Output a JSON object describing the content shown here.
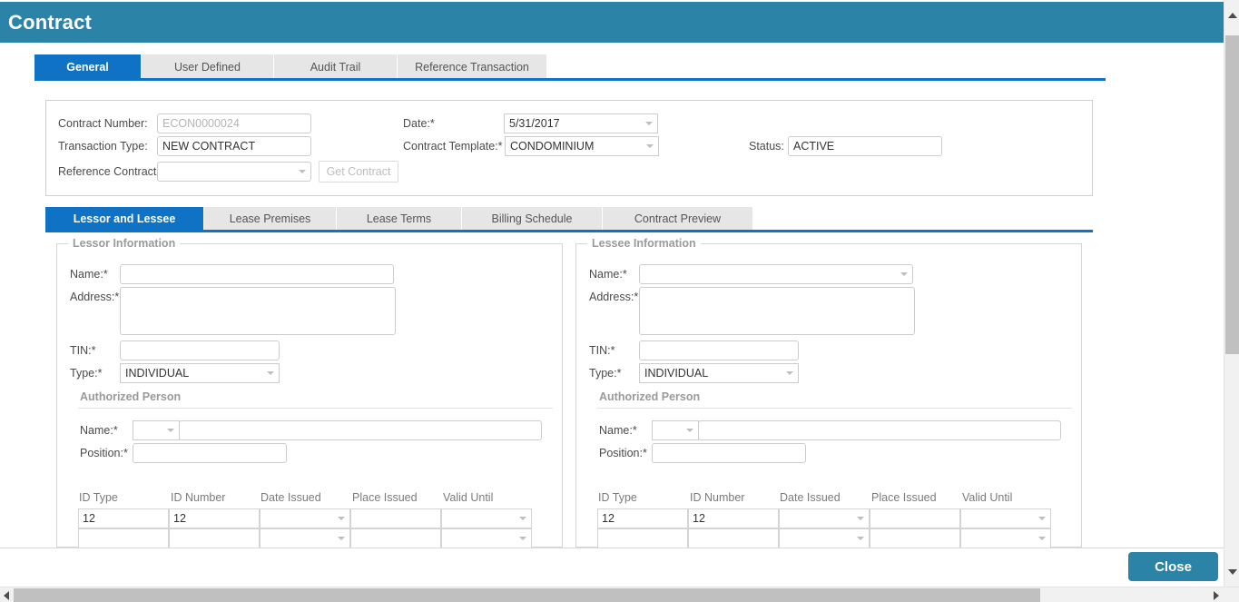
{
  "window": {
    "title": "Contract"
  },
  "colors": {
    "header_teal": "#2c83a8",
    "tab_active_blue": "#0f72c4",
    "tab_inactive_grey": "#e6e6e6",
    "close_button": "#2c83a8",
    "field_border": "#cccccc",
    "legend_grey": "#9a9a9a"
  },
  "main_tabs": [
    {
      "label": "General",
      "active": true
    },
    {
      "label": "User Defined",
      "active": false
    },
    {
      "label": "Audit Trail",
      "active": false
    },
    {
      "label": "Reference Transaction",
      "active": false
    }
  ],
  "header_form": {
    "contract_number": {
      "label": "Contract Number:",
      "value": "ECON0000024",
      "readonly": true
    },
    "transaction_type": {
      "label": "Transaction Type:",
      "value": "NEW CONTRACT"
    },
    "reference_contract": {
      "label": "Reference Contract:",
      "value": ""
    },
    "get_contract_button": {
      "label": "Get Contract",
      "disabled": true
    },
    "date": {
      "label": "Date:*",
      "value": "5/31/2017"
    },
    "contract_template": {
      "label": "Contract Template:*",
      "value": "CONDOMINIUM"
    },
    "status": {
      "label": "Status:",
      "value": "ACTIVE"
    }
  },
  "sub_tabs": [
    {
      "label": "Lessor and Lessee",
      "active": true
    },
    {
      "label": "Lease Premises",
      "active": false
    },
    {
      "label": "Lease Terms",
      "active": false
    },
    {
      "label": "Billing Schedule",
      "active": false
    },
    {
      "label": "Contract Preview",
      "active": false
    }
  ],
  "lessor": {
    "legend": "Lessor Information",
    "name": {
      "label": "Name:*",
      "value": ""
    },
    "address": {
      "label": "Address:*",
      "value": ""
    },
    "tin": {
      "label": "TIN:*",
      "value": ""
    },
    "type": {
      "label": "Type:*",
      "value": "INDIVIDUAL"
    },
    "authorized_person": {
      "heading": "Authorized Person",
      "name": {
        "label": "Name:*",
        "prefix_value": "",
        "value": ""
      },
      "position": {
        "label": "Position:*",
        "value": ""
      },
      "id_table": {
        "columns": [
          "ID Type",
          "ID Number",
          "Date Issued",
          "Place Issued",
          "Valid Until"
        ],
        "rows": [
          {
            "id_type": "12",
            "id_number": "12",
            "date_issued": "",
            "place_issued": "",
            "valid_until": ""
          },
          {
            "id_type": "",
            "id_number": "",
            "date_issued": "",
            "place_issued": "",
            "valid_until": ""
          }
        ]
      }
    }
  },
  "lessee": {
    "legend": "Lessee Information",
    "name": {
      "label": "Name:*",
      "value": ""
    },
    "address": {
      "label": "Address:*",
      "value": ""
    },
    "tin": {
      "label": "TIN:*",
      "value": ""
    },
    "type": {
      "label": "Type:*",
      "value": "INDIVIDUAL"
    },
    "authorized_person": {
      "heading": "Authorized Person",
      "name": {
        "label": "Name:*",
        "prefix_value": "",
        "value": ""
      },
      "position": {
        "label": "Position:*",
        "value": ""
      },
      "id_table": {
        "columns": [
          "ID Type",
          "ID Number",
          "Date Issued",
          "Place Issued",
          "Valid Until"
        ],
        "rows": [
          {
            "id_type": "12",
            "id_number": "12",
            "date_issued": "",
            "place_issued": "",
            "valid_until": ""
          },
          {
            "id_type": "",
            "id_number": "",
            "date_issued": "",
            "place_issued": "",
            "valid_until": ""
          }
        ]
      }
    }
  },
  "footer": {
    "close_label": "Close"
  },
  "scrollbars": {
    "vertical_icon_up": "scroll-up-arrow",
    "vertical_icon_down": "scroll-down-arrow",
    "horizontal_icon_left": "scroll-left-arrow",
    "horizontal_icon_right": "scroll-right-arrow"
  }
}
